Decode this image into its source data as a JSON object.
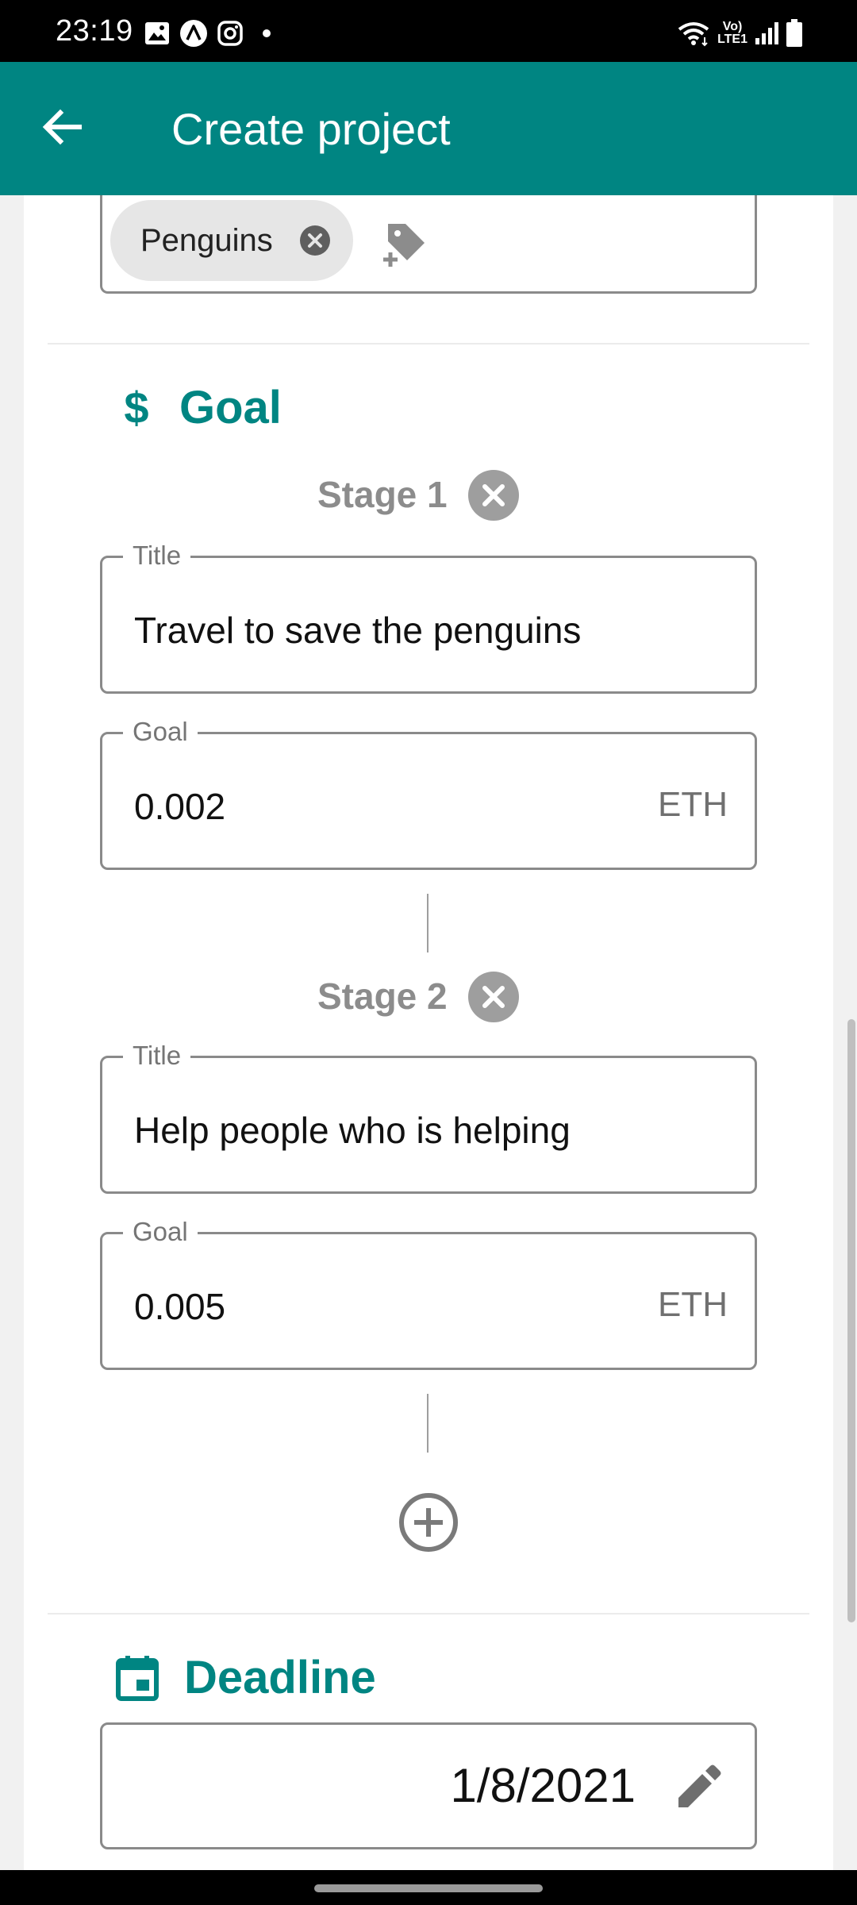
{
  "status_bar": {
    "time": "23:19",
    "left_icons": [
      "gallery-icon",
      "app-a-icon",
      "instagram-icon",
      "dot-icon"
    ],
    "right_icons": [
      "wifi-icon",
      "volte-icon",
      "signal-icon",
      "battery-icon"
    ],
    "network_label_top": "Vo)",
    "network_label_bottom": "LTE1"
  },
  "app_bar": {
    "title": "Create project",
    "back_icon": "arrow-back-icon",
    "color": "#008582"
  },
  "tags": {
    "chips": [
      {
        "label": "Penguins"
      }
    ],
    "add_icon": "add-tag-icon"
  },
  "goal_section": {
    "title": "Goal",
    "icon": "dollar-icon",
    "stages": [
      {
        "label": "Stage 1",
        "title_label": "Title",
        "title_value": "Travel to save the penguins",
        "goal_label": "Goal",
        "goal_value": "0.002",
        "goal_unit": "ETH"
      },
      {
        "label": "Stage 2",
        "title_label": "Title",
        "title_value": "Help people who is helping",
        "goal_label": "Goal",
        "goal_value": "0.005",
        "goal_unit": "ETH"
      }
    ],
    "add_stage_icon": "add-circle-icon"
  },
  "deadline_section": {
    "title": "Deadline",
    "icon": "calendar-icon",
    "date_value": "1/8/2021",
    "edit_icon": "pencil-icon"
  },
  "colors": {
    "accent": "#008582",
    "muted_text": "#8c8c8c",
    "border": "#8a8a8a"
  }
}
